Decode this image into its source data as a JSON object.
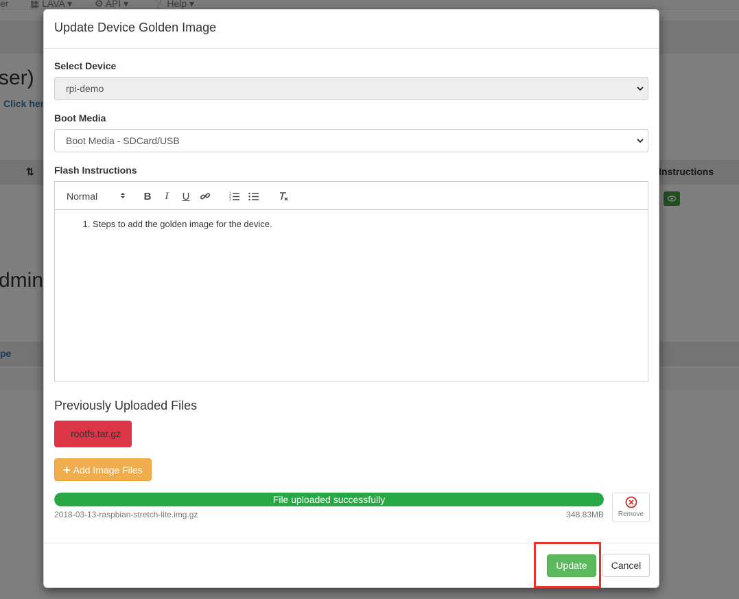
{
  "background": {
    "nav": {
      "item1": "er",
      "lava": "LAVA",
      "api": "API",
      "help": "Help"
    },
    "heading1": "ser)",
    "link1": "Click her",
    "th_instructions": "Instructions",
    "heading2": "dmin)",
    "th_type": "pe"
  },
  "modal": {
    "title": "Update Device Golden Image",
    "select_device": {
      "label": "Select Device",
      "value": "rpi-demo"
    },
    "boot_media": {
      "label": "Boot Media",
      "value": "Boot Media - SDCard/USB"
    },
    "flash_instructions": {
      "label": "Flash Instructions",
      "heading_select": "Normal",
      "toolbar": [
        "bold-icon",
        "italic-icon",
        "underline-icon",
        "link-icon",
        "ordered-list-icon",
        "bullet-list-icon",
        "clear-format-icon"
      ],
      "content": [
        "Steps to add the golden image for the device."
      ]
    },
    "previous_files": {
      "title": "Previously Uploaded Files",
      "files": [
        "rootfs.tar.gz"
      ]
    },
    "add_button": "Add Image Files",
    "upload": {
      "status": "File uploaded successfully",
      "progress": 1.0,
      "filename": "2018-03-13-raspbian-stretch-lite.img.gz",
      "size": "348.83MB",
      "remove_label": "Remove"
    },
    "footer": {
      "update": "Update",
      "cancel": "Cancel"
    },
    "colors": {
      "danger": "#dc3545",
      "success": "#28a745",
      "warning": "#f0ad4e",
      "primary_btn": "#5cb85c",
      "highlight": "#e8322d"
    }
  }
}
